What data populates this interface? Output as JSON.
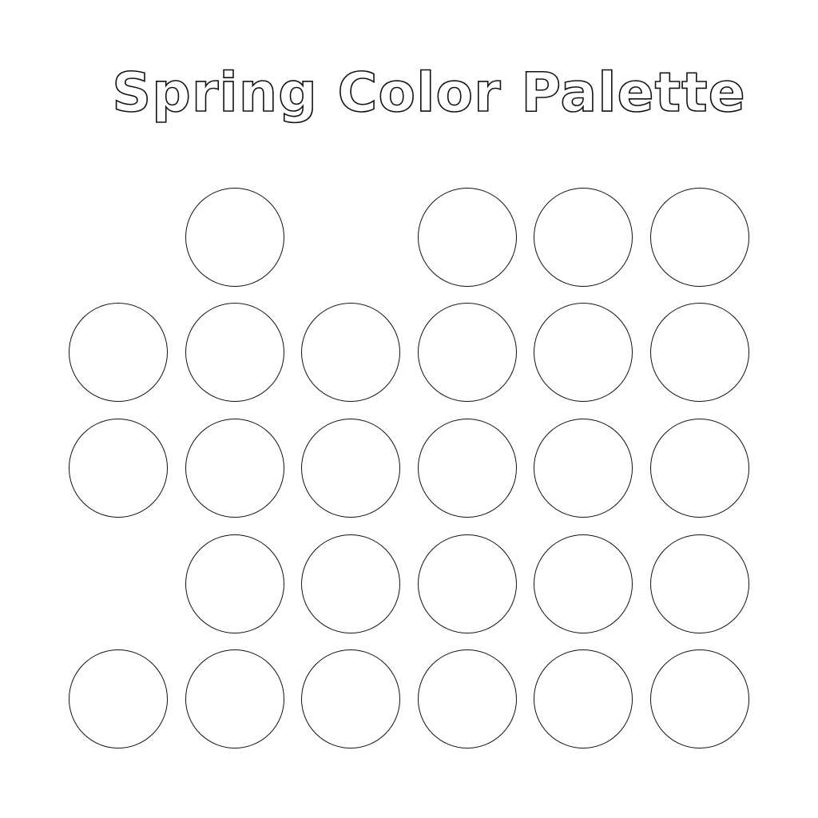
{
  "title": "Spring Color Palette",
  "swatch_rows": [
    [
      false,
      true,
      false,
      true,
      true,
      true
    ],
    [
      true,
      true,
      true,
      true,
      true,
      true
    ],
    [
      true,
      true,
      true,
      true,
      true,
      true
    ],
    [
      false,
      true,
      true,
      true,
      true,
      true
    ],
    [
      true,
      true,
      true,
      true,
      true,
      true
    ]
  ],
  "swatch_fill": "#ffffff",
  "outline_color": "#111111"
}
